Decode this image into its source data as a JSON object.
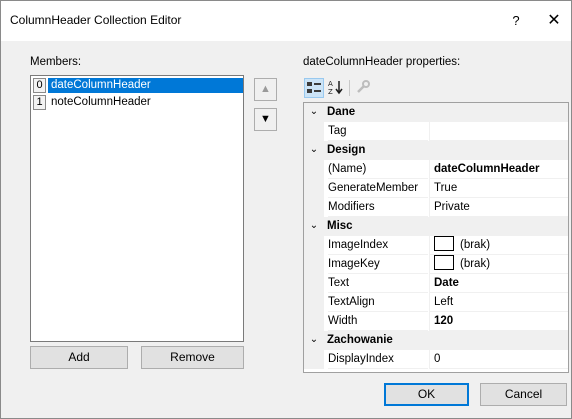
{
  "window": {
    "title": "ColumnHeader Collection Editor",
    "help_label": "?",
    "close_label": "✕"
  },
  "members": {
    "label": "Members:",
    "items": [
      {
        "index": "0",
        "name": "dateColumnHeader",
        "selected": true
      },
      {
        "index": "1",
        "name": "noteColumnHeader",
        "selected": false
      }
    ],
    "move_up_icon": "▲",
    "move_down_icon": "▼",
    "add_label": "Add",
    "remove_label": "Remove"
  },
  "properties": {
    "label": "dateColumnHeader properties:",
    "toolbar": {
      "categorized_icon": "categorized-icon",
      "alphabetical_icon": "alphabetical-icon",
      "property_pages_icon": "wrench-icon"
    },
    "categories": [
      {
        "name": "Dane",
        "rows": [
          {
            "name": "Tag",
            "value": ""
          }
        ]
      },
      {
        "name": "Design",
        "rows": [
          {
            "name": "(Name)",
            "value": "dateColumnHeader"
          },
          {
            "name": "GenerateMember",
            "value": "True"
          },
          {
            "name": "Modifiers",
            "value": "Private"
          }
        ]
      },
      {
        "name": "Misc",
        "rows": [
          {
            "name": "ImageIndex",
            "value": "(brak)"
          },
          {
            "name": "ImageKey",
            "value": "(brak)"
          },
          {
            "name": "Text",
            "value": "Date"
          },
          {
            "name": "TextAlign",
            "value": "Left"
          },
          {
            "name": "Width",
            "value": "120"
          }
        ]
      },
      {
        "name": "Zachowanie",
        "rows": [
          {
            "name": "DisplayIndex",
            "value": "0"
          }
        ]
      }
    ]
  },
  "footer": {
    "ok_label": "OK",
    "cancel_label": "Cancel"
  },
  "colors": {
    "selection": "#0078d7",
    "window_bg": "#f0f0f0"
  }
}
